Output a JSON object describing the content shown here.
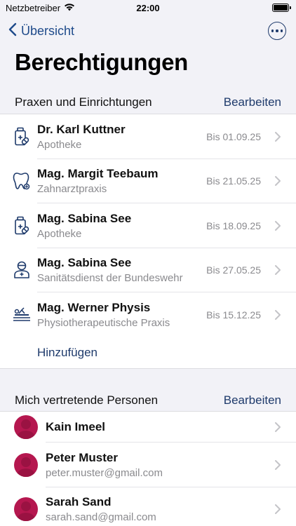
{
  "status_bar": {
    "carrier": "Netzbetreiber",
    "time": "22:00"
  },
  "nav": {
    "back_label": "Übersicht"
  },
  "page": {
    "title": "Berechtigungen"
  },
  "facilities": {
    "header": "Praxen und Einrichtungen",
    "edit_label": "Bearbeiten",
    "items": [
      {
        "name": "Dr. Karl Kuttner",
        "type": "Apotheke",
        "valid_until": "Bis 01.09.25",
        "icon": "pharmacy-icon"
      },
      {
        "name": "Mag. Margit Teebaum",
        "type": "Zahnarztpraxis",
        "valid_until": "Bis 21.05.25",
        "icon": "tooth-icon"
      },
      {
        "name": "Mag. Sabina See",
        "type": "Apotheke",
        "valid_until": "Bis 18.09.25",
        "icon": "pharmacy-icon"
      },
      {
        "name": "Mag. Sabina See",
        "type": "Sanitätsdienst der Bundeswehr",
        "valid_until": "Bis 27.05.25",
        "icon": "medic-icon"
      },
      {
        "name": "Mag. Werner Physis",
        "type": "Physiotherapeutische Praxis",
        "valid_until": "Bis 15.12.25",
        "icon": "physio-icon"
      }
    ],
    "add_label": "Hinzufügen"
  },
  "representatives": {
    "header": "Mich vertretende Personen",
    "edit_label": "Bearbeiten",
    "items": [
      {
        "name": "Kain Imeel",
        "email": ""
      },
      {
        "name": "Peter Muster",
        "email": "peter.muster@gmail.com"
      },
      {
        "name": "Sarah Sand",
        "email": "sarah.sand@gmail.com"
      }
    ]
  },
  "colors": {
    "accent": "#1e3a6b",
    "avatar": "#b5174f",
    "background": "#f2f2f7"
  }
}
